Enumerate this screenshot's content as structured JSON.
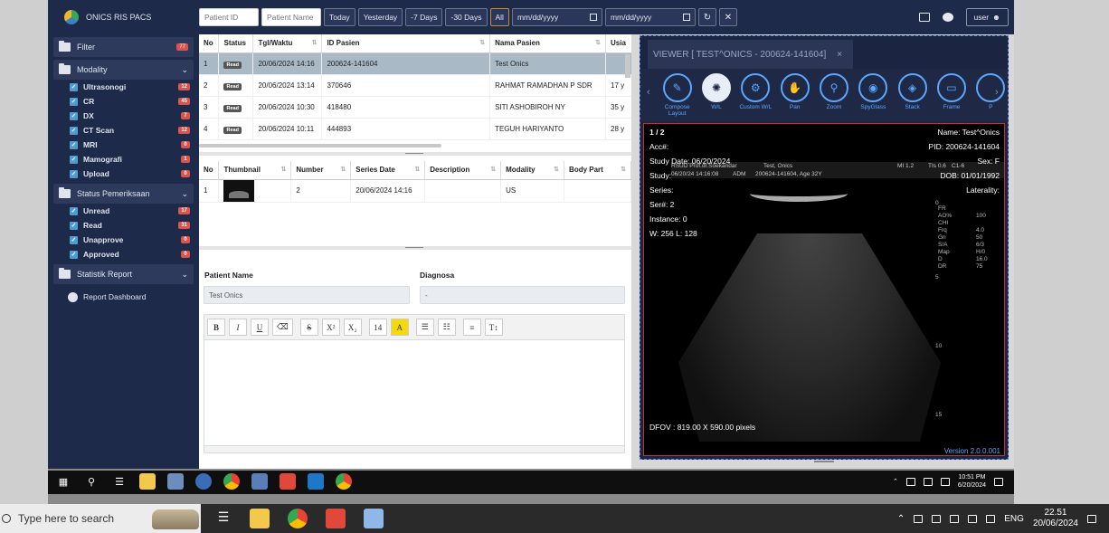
{
  "app": {
    "brand": "ONICS RIS PACS"
  },
  "topbar": {
    "patient_id_placeholder": "Patient ID",
    "patient_name_placeholder": "Patient Name",
    "buttons": [
      "Today",
      "Yesterday",
      "-7 Days",
      "-30 Days",
      "All"
    ],
    "date_from": "mm/dd/yyyy",
    "date_to": "mm/dd/yyyy",
    "refresh_icon": "↻",
    "clear_icon": "✕",
    "user_label": "user"
  },
  "sidebar": {
    "filter": {
      "label": "Filter",
      "count": "77"
    },
    "modality": {
      "label": "Modality",
      "items": [
        {
          "label": "Ultrasonogi",
          "count": "12"
        },
        {
          "label": "CR",
          "count": "45"
        },
        {
          "label": "DX",
          "count": "7"
        },
        {
          "label": "CT Scan",
          "count": "12"
        },
        {
          "label": "MRI",
          "count": "0"
        },
        {
          "label": "Mamografi",
          "count": "1"
        },
        {
          "label": "Upload",
          "count": "0"
        }
      ]
    },
    "status": {
      "label": "Status Pemeriksaan",
      "items": [
        {
          "label": "Unread",
          "count": "17"
        },
        {
          "label": "Read",
          "count": "31"
        },
        {
          "label": "Unapprove",
          "count": "0"
        },
        {
          "label": "Approved",
          "count": "0"
        }
      ]
    },
    "report": {
      "label": "Statistik Report",
      "sub": "Report Dashboard"
    }
  },
  "worklist": {
    "headers": [
      "No",
      "Status",
      "Tgl/Waktu",
      "ID Pasien",
      "Nama Pasien",
      "Usia"
    ],
    "rows": [
      {
        "no": "1",
        "status": "Read",
        "time": "20/06/2024 14:16",
        "id": "200624-141604",
        "name": "Test Onics",
        "age": ""
      },
      {
        "no": "2",
        "status": "Read",
        "time": "20/06/2024 13:14",
        "id": "370646",
        "name": "RAHMAT RAMADHAN P SDR",
        "age": "17 y"
      },
      {
        "no": "3",
        "status": "Read",
        "time": "20/06/2024 10:30",
        "id": "418480",
        "name": "SITI ASHOBIROH NY",
        "age": "35 y"
      },
      {
        "no": "4",
        "status": "Read",
        "time": "20/06/2024 10:11",
        "id": "444893",
        "name": "TEGUH HARIYANTO",
        "age": "28 y"
      }
    ]
  },
  "series": {
    "headers": [
      "No",
      "Thumbnail",
      "Number",
      "Series Date",
      "Description",
      "Modality",
      "Body Part"
    ],
    "rows": [
      {
        "no": "1",
        "number": "2",
        "date": "20/06/2024 14:16",
        "description": "",
        "modality": "US",
        "body_part": ""
      }
    ]
  },
  "report_form": {
    "patient_name_label": "Patient Name",
    "patient_name_value": "Test Onics",
    "diagnosa_label": "Diagnosa",
    "diagnosa_value": "-",
    "toolbar": [
      "B",
      "I",
      "U",
      "⌫",
      "S",
      "X²",
      "X₂",
      "14",
      "A",
      "☰",
      "☷",
      "≡",
      "T↕"
    ]
  },
  "viewer": {
    "tab_title": "VIEWER [ TEST^ONICS - 200624-141604]",
    "tab_close": "×",
    "tools": [
      {
        "label": "Compose Layout",
        "icon": "✎"
      },
      {
        "label": "W/L",
        "icon": "✺"
      },
      {
        "label": "Custom W/L",
        "icon": "⚙"
      },
      {
        "label": "Pan",
        "icon": "✋"
      },
      {
        "label": "Zoom",
        "icon": "⚲"
      },
      {
        "label": "SpyGlass",
        "icon": "◉"
      },
      {
        "label": "Stack",
        "icon": "◈"
      },
      {
        "label": "Frame",
        "icon": "▭"
      },
      {
        "label": "P",
        "icon": ""
      }
    ],
    "overlay": {
      "frame": "1 / 2",
      "acc": "Acc#:",
      "study_date": "Study Date: 06/20/2024",
      "study": "Study:",
      "series": "Series:",
      "ser": "Ser#: 2",
      "instance": "Instance: 0",
      "wl": "W: 256 L: 128",
      "name": "Name: Test^Onics",
      "pid": "PID: 200624-141604",
      "sex": "Sex: F",
      "dob": "DOB: 01/01/1992",
      "laterality": "Laterality:",
      "dfov": "DFOV : 819.00 X 590.00 pixels",
      "version": "Version 2.0.0.001"
    },
    "us_strip": {
      "hospital": "RSUD Prof.dr.Soekandar",
      "patient": "Test, Onics",
      "mi": "MI 1.2",
      "tis": "TIs 0.6",
      "probe": "C1-6",
      "date": "06/20/24 14:16:08",
      "adm": "ADM",
      "id_age": "200624-141604, Age 32Y"
    },
    "us_params": [
      {
        "k": "FR",
        "v": ""
      },
      {
        "k": "AO%",
        "v": "100"
      },
      {
        "k": "CHI",
        "v": ""
      },
      {
        "k": "Frq",
        "v": "4.0"
      },
      {
        "k": "Gn",
        "v": "50"
      },
      {
        "k": "S/A",
        "v": "6/3"
      },
      {
        "k": "Map",
        "v": "H/0"
      },
      {
        "k": "D",
        "v": "16.0"
      },
      {
        "k": "DR",
        "v": "75"
      }
    ],
    "depth_ticks": [
      "0",
      "5",
      "10",
      "15"
    ]
  },
  "inner_taskbar": {
    "time": "10:51 PM",
    "date": "6/20/2024"
  },
  "outer_taskbar": {
    "search_placeholder": "Type here to search",
    "lang": "ENG",
    "time": "22.51",
    "date": "20/06/2024"
  },
  "colors": {
    "sidebar_bg": "#1e2a4a",
    "badge": "#d9534f",
    "viewer_accent": "#5aa7ff",
    "selected_row": "#a9b9c6"
  }
}
